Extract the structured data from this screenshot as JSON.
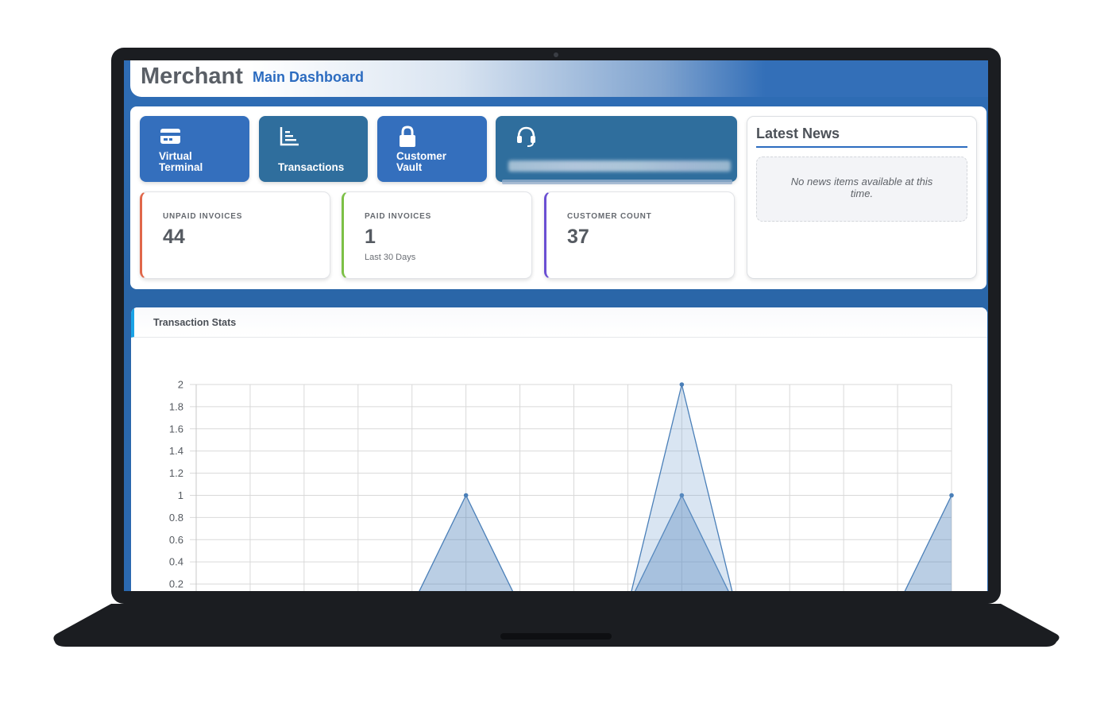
{
  "header": {
    "brand": "Merchant",
    "subtitle": "Main Dashboard"
  },
  "tiles": [
    {
      "label": "Virtual\nTerminal",
      "icon": "credit-card-icon"
    },
    {
      "label": "Transactions",
      "icon": "list-chart-icon"
    },
    {
      "label": "Customer\nVault",
      "icon": "lock-icon"
    },
    {
      "label": "",
      "icon": "headset-icon"
    }
  ],
  "stats": [
    {
      "caption": "UNPAID INVOICES",
      "value": "44",
      "note": "",
      "accent": "#e0674a"
    },
    {
      "caption": "PAID INVOICES",
      "value": "1",
      "note": "Last 30 Days",
      "accent": "#7cc046"
    },
    {
      "caption": "CUSTOMER COUNT",
      "value": "37",
      "note": "",
      "accent": "#6a4fd3"
    }
  ],
  "news": {
    "title": "Latest News",
    "empty_message": "No news items available at this time."
  },
  "chart_panel": {
    "title": "Transaction Stats"
  },
  "chart_data": {
    "type": "area",
    "title": "",
    "xlabel": "",
    "ylabel": "",
    "ylim": [
      0,
      2
    ],
    "yticks": [
      "2",
      "1.8",
      "1.6",
      "1.4",
      "1.2",
      "1",
      "0.8",
      "0.6",
      "0.4",
      "0.2"
    ],
    "grid": true,
    "x": [
      0,
      1,
      2,
      3,
      4,
      5,
      6,
      7,
      8,
      9,
      10,
      11,
      12,
      13,
      14
    ],
    "series": [
      {
        "values": [
          0,
          0,
          0,
          0,
          0,
          1,
          0,
          0,
          0,
          1,
          0,
          0,
          0,
          0,
          1
        ],
        "color": "#4a7fb8"
      },
      {
        "values": [
          0,
          0,
          0,
          0,
          0,
          0,
          0,
          0,
          0,
          2,
          0,
          0,
          0,
          0,
          0
        ],
        "color": "#4a7fb8"
      }
    ]
  },
  "colors": {
    "brand_blue": "#2c6cc0",
    "tile_blue": "#346fbd",
    "tile_dark": "#2f6e9d"
  }
}
